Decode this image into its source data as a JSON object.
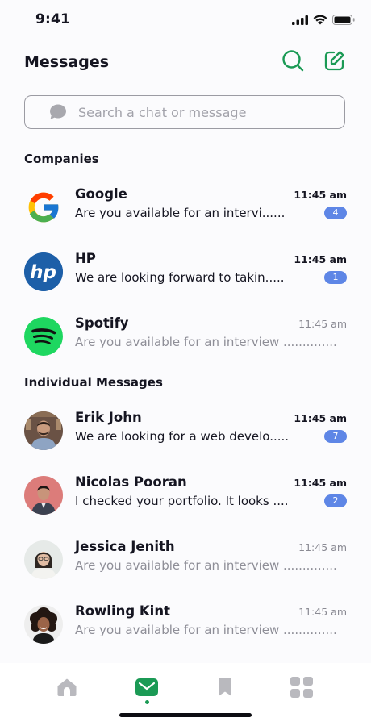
{
  "status_bar": {
    "time": "9:41",
    "icons": [
      "signal-icon",
      "wifi-icon",
      "battery-icon"
    ]
  },
  "header": {
    "title": "Messages",
    "actions": [
      "search-icon",
      "compose-icon"
    ]
  },
  "search": {
    "placeholder": "Search a chat or message",
    "value": ""
  },
  "sections": {
    "companies": "Companies",
    "individual": "Individual Messages"
  },
  "companies": [
    {
      "name": "Google",
      "time": "11:45 am",
      "preview": "Are you available for an intervi......",
      "unread": "4",
      "avatar": "google-logo"
    },
    {
      "name": "HP",
      "time": "11:45 am",
      "preview": "We are looking forward to takin.....",
      "unread": "1",
      "avatar": "hp-logo"
    },
    {
      "name": "Spotify",
      "time": "11:45 am",
      "preview": "Are you available for an interview ..............",
      "unread": "",
      "avatar": "spotify-logo"
    }
  ],
  "individuals": [
    {
      "name": "Erik John",
      "time": "11:45 am",
      "preview": "We are looking for a web develo.....",
      "unread": "7",
      "avatar": "photo-erik-john"
    },
    {
      "name": "Nicolas Pooran",
      "time": "11:45 am",
      "preview": "I checked your portfolio. It looks ....",
      "unread": "2",
      "avatar": "photo-nicolas-pooran"
    },
    {
      "name": "Jessica Jenith",
      "time": "11:45 am",
      "preview": "Are you available for an interview ..............",
      "unread": "",
      "avatar": "photo-jessica-jenith"
    },
    {
      "name": "Rowling Kint",
      "time": "11:45 am",
      "preview": "Are you available for an interview ..............",
      "unread": "",
      "avatar": "photo-rowling-kint"
    }
  ],
  "bottom_nav": {
    "items": [
      "home-icon",
      "messages-icon",
      "bookmark-icon",
      "apps-grid-icon"
    ],
    "active": "messages-icon"
  },
  "colors": {
    "accent": "#1b9a55",
    "badge": "#5e86e6",
    "text": "#151521",
    "muted": "#8e8e97"
  }
}
